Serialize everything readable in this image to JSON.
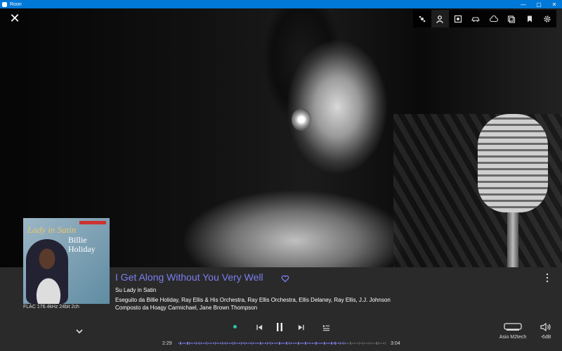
{
  "window": {
    "title": "Roon",
    "controls": [
      "—",
      "▢",
      "✕"
    ]
  },
  "header": {
    "close_glyph": "✕"
  },
  "toolbar": {
    "buttons": [
      {
        "icon": "radio-icon"
      },
      {
        "icon": "person-icon",
        "active": true
      },
      {
        "icon": "album-icon"
      },
      {
        "icon": "car-icon"
      },
      {
        "icon": "cloud-icon"
      },
      {
        "icon": "queue-icon"
      },
      {
        "icon": "bookmark-icon"
      },
      {
        "icon": "gear-icon"
      }
    ]
  },
  "now_playing": {
    "album_cover": {
      "title": "Lady in Satin",
      "artist_lines": "Billie Holiday"
    },
    "format": "FLAC 176.4kHz 24bit 2ch",
    "track_title": "I Get Along Without You Very Well",
    "album_line": "Su Lady in Satin",
    "artists_line": "Eseguito da Billie Holiday, Ray Ellis & His Orchestra, Ray Ellis Orchestra, Ellis Delaney, Ray Ellis, J.J. Johnson",
    "composer_line": "Composto da Hoagy Carmichael, Jane Brown Thompson"
  },
  "transport": {
    "elapsed": "2:29",
    "total": "3:04",
    "progress": 0.81
  },
  "zone": {
    "name": "Asio M2tech"
  },
  "volume": {
    "level": "-6dB"
  },
  "colors": {
    "accent": "#7b7ff0",
    "status": "#2fc4a6",
    "titlebar": "#0078d7",
    "panel": "#2a2a2a"
  }
}
